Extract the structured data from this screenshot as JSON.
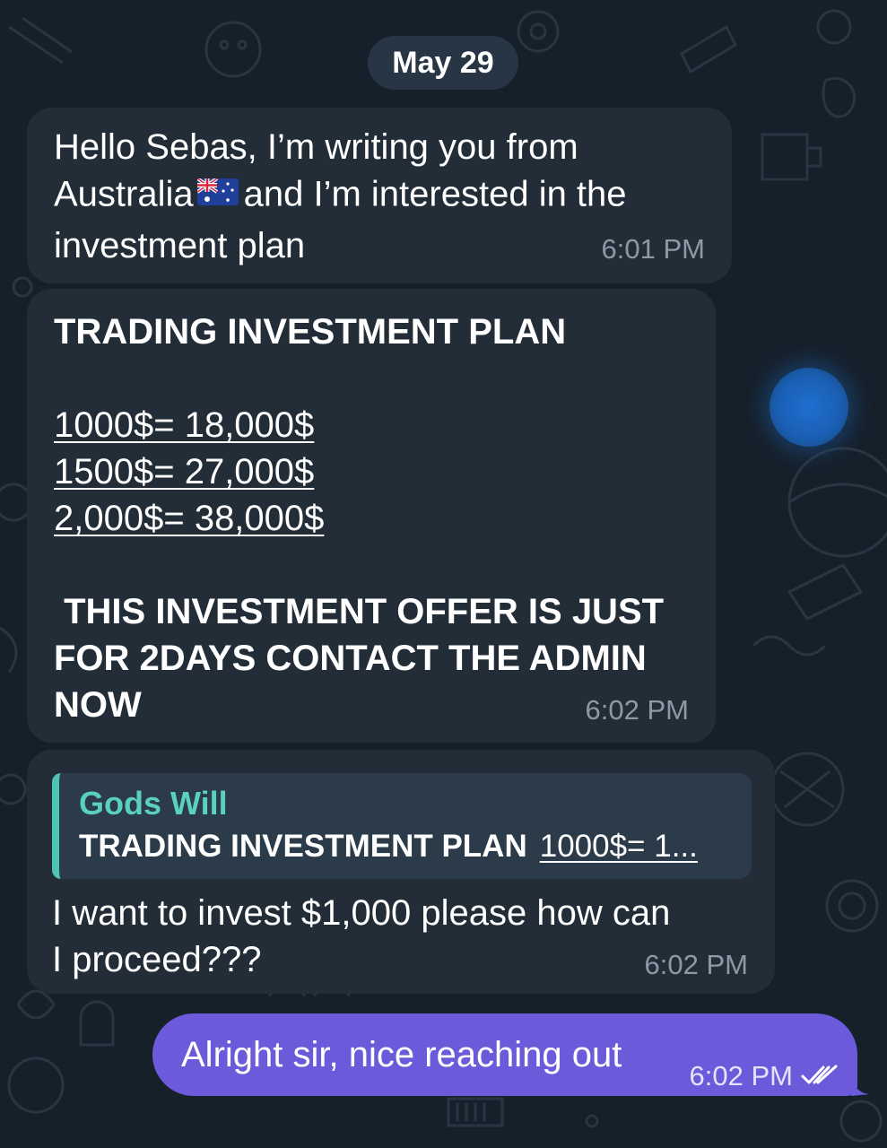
{
  "date_label": "May 29",
  "messages": [
    {
      "lines": [
        "Hello Sebas, I’m writing you from",
        "Australia",
        "and I’m interested in the",
        "investment plan"
      ],
      "flag_icon": "australia-flag-emoji",
      "time": "6:01 PM"
    },
    {
      "title": "TRADING INVESTMENT PLAN",
      "plans": [
        "1000$= 18,000$",
        "1500$= 27,000$",
        "2,000$= 38,000$"
      ],
      "offer_lines": [
        " THIS INVESTMENT OFFER IS JUST",
        "FOR 2DAYS CONTACT THE ADMIN",
        "NOW"
      ],
      "time": "6:02 PM"
    },
    {
      "reply": {
        "author": "Gods Will",
        "title": "TRADING INVESTMENT PLAN",
        "snippet": "1000$= 1..."
      },
      "lines": [
        "I want to invest $1,000 please how can",
        "I proceed???"
      ],
      "time": "6:02 PM"
    },
    {
      "text": "Alright sir, nice reaching out",
      "time": "6:02 PM",
      "status_icon": "double-check-icon"
    }
  ],
  "colors": {
    "background": "#16202b",
    "incoming_bubble": "#222d38",
    "outgoing_bubble": "#6b5ad9",
    "reply_accent": "#4fc4b4",
    "timestamp": "#8d99a4"
  }
}
